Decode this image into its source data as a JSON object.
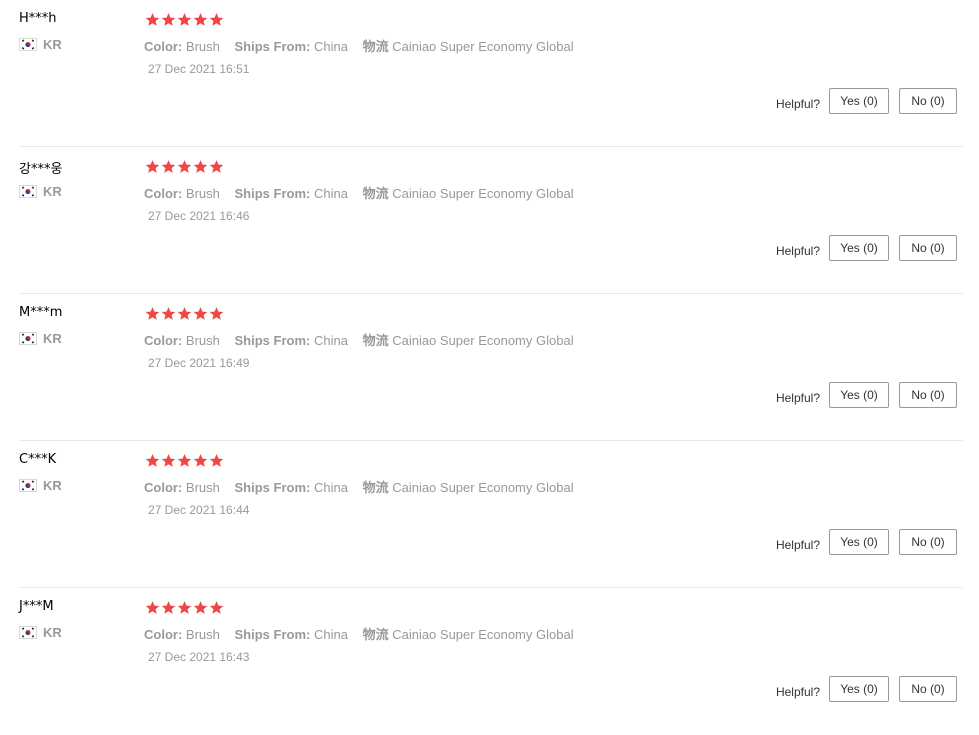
{
  "labels": {
    "color_key": "Color:",
    "ships_from_key": "Ships From:",
    "logistics_key": "物流",
    "helpful": "Helpful?",
    "yes": "Yes (0)",
    "no": "No (0)"
  },
  "colors": {
    "star": "#f04646",
    "muted_text": "#999999"
  },
  "reviews": [
    {
      "user": "H***h",
      "country": "KR",
      "rating": 5,
      "color": "Brush",
      "ships_from": "China",
      "logistics": "Cainiao Super Economy Global",
      "date": "27 Dec 2021 16:51"
    },
    {
      "user": "강***웅",
      "country": "KR",
      "rating": 5,
      "color": "Brush",
      "ships_from": "China",
      "logistics": "Cainiao Super Economy Global",
      "date": "27 Dec 2021 16:46"
    },
    {
      "user": "M***m",
      "country": "KR",
      "rating": 5,
      "color": "Brush",
      "ships_from": "China",
      "logistics": "Cainiao Super Economy Global",
      "date": "27 Dec 2021 16:49"
    },
    {
      "user": "C***K",
      "country": "KR",
      "rating": 5,
      "color": "Brush",
      "ships_from": "China",
      "logistics": "Cainiao Super Economy Global",
      "date": "27 Dec 2021 16:44"
    },
    {
      "user": "J***M",
      "country": "KR",
      "rating": 5,
      "color": "Brush",
      "ships_from": "China",
      "logistics": "Cainiao Super Economy Global",
      "date": "27 Dec 2021 16:43"
    }
  ]
}
